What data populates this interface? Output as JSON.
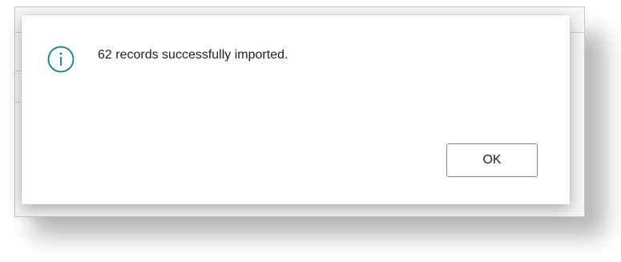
{
  "dialog": {
    "icon": "info-circle-icon",
    "accent_color": "#00838f",
    "message": "62 records successfully imported.",
    "ok_label": "OK"
  }
}
